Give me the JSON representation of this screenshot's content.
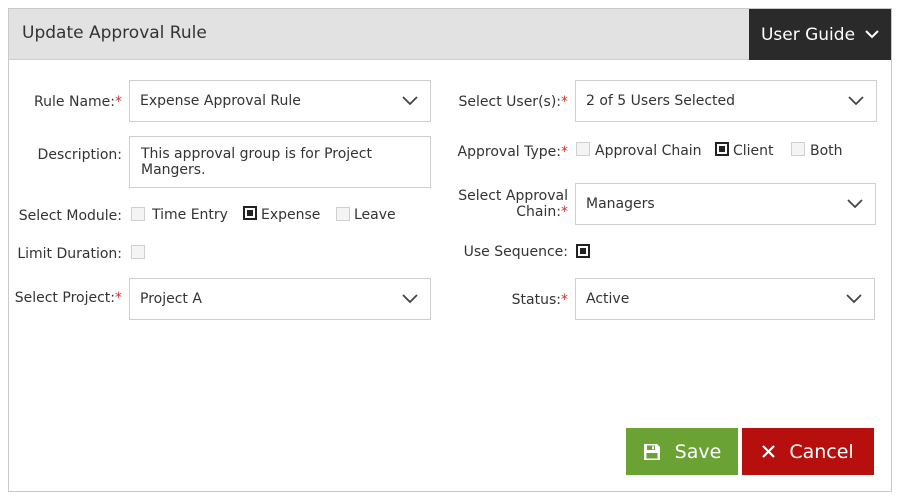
{
  "dialog": {
    "title": "Update Approval Rule",
    "user_guide_label": "User Guide"
  },
  "form": {
    "rule_name": {
      "label": "Rule Name:",
      "required_mark": "*",
      "value": "Expense Approval Rule"
    },
    "description": {
      "label": "Description:",
      "value": "This approval group is for Project Mangers."
    },
    "select_module": {
      "label": "Select Module:",
      "options": [
        {
          "label": "Time Entry",
          "checked": false
        },
        {
          "label": "Expense",
          "checked": true
        },
        {
          "label": "Leave",
          "checked": false
        }
      ]
    },
    "limit_duration": {
      "label": "Limit Duration:",
      "checked": false
    },
    "select_project": {
      "label": "Select Project:",
      "required_mark": "*",
      "value": "Project A"
    },
    "select_users": {
      "label": "Select User(s):",
      "required_mark": "*",
      "value": "2 of 5 Users Selected"
    },
    "approval_type": {
      "label": "Approval Type:",
      "required_mark": "*",
      "options": [
        {
          "label": "Approval Chain",
          "checked": false
        },
        {
          "label": "Client",
          "checked": true
        },
        {
          "label": "Both",
          "checked": false
        }
      ]
    },
    "approval_chain": {
      "label_line1": "Select Approval",
      "label_line2": "Chain:",
      "required_mark": "*",
      "value": "Managers"
    },
    "use_sequence": {
      "label": "Use Sequence:",
      "checked": true
    },
    "status": {
      "label": "Status:",
      "required_mark": "*",
      "value": "Active"
    }
  },
  "actions": {
    "save_label": "Save",
    "cancel_label": "Cancel"
  },
  "colors": {
    "header_bg": "#e2e2e2",
    "guide_bg": "#2a2a2a",
    "required": "#d32f2f",
    "save_bg": "#6aa233",
    "cancel_bg": "#b70e0e"
  },
  "icons": {
    "guide_chevron": "chevron-down-icon",
    "dropdown_chevron": "chevron-down-icon",
    "save": "floppy-disk-icon",
    "cancel": "close-icon"
  }
}
